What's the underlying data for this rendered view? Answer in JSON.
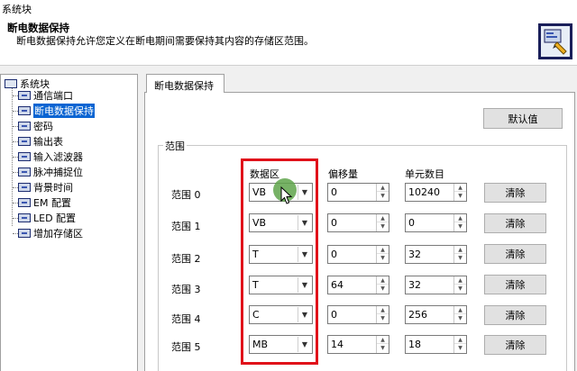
{
  "window": {
    "title": "系统块"
  },
  "header": {
    "title": "断电数据保持",
    "description": "断电数据保持允许您定义在断电期间需要保持其内容的存储区范围。",
    "icon": "system-block-icon"
  },
  "tree": {
    "root": "系统块",
    "items": [
      {
        "label": "通信端口",
        "selected": false
      },
      {
        "label": "断电数据保持",
        "selected": true
      },
      {
        "label": "密码",
        "selected": false
      },
      {
        "label": "输出表",
        "selected": false
      },
      {
        "label": "输入滤波器",
        "selected": false
      },
      {
        "label": "脉冲捕捉位",
        "selected": false
      },
      {
        "label": "背景时间",
        "selected": false
      },
      {
        "label": "EM 配置",
        "selected": false
      },
      {
        "label": "LED 配置",
        "selected": false
      },
      {
        "label": "增加存储区",
        "selected": false
      }
    ]
  },
  "tab": {
    "label": "断电数据保持"
  },
  "default_button": "默认值",
  "group": {
    "label": "范围",
    "col_area": "数据区",
    "col_offset": "偏移量",
    "col_count": "单元数目",
    "rows": [
      {
        "label": "范围 0",
        "area": "VB",
        "offset": "0",
        "count": "10240",
        "clear": "清除"
      },
      {
        "label": "范围 1",
        "area": "VB",
        "offset": "0",
        "count": "0",
        "clear": "清除"
      },
      {
        "label": "范围 2",
        "area": "T",
        "offset": "0",
        "count": "32",
        "clear": "清除"
      },
      {
        "label": "范围 3",
        "area": "T",
        "offset": "64",
        "count": "32",
        "clear": "清除"
      },
      {
        "label": "范围 4",
        "area": "C",
        "offset": "0",
        "count": "256",
        "clear": "清除"
      },
      {
        "label": "范围 5",
        "area": "MB",
        "offset": "14",
        "count": "18",
        "clear": "清除"
      }
    ]
  },
  "colors": {
    "highlight": "#e0111a",
    "selection": "#0a64d2",
    "cursor_dot": "#5fa54b"
  }
}
